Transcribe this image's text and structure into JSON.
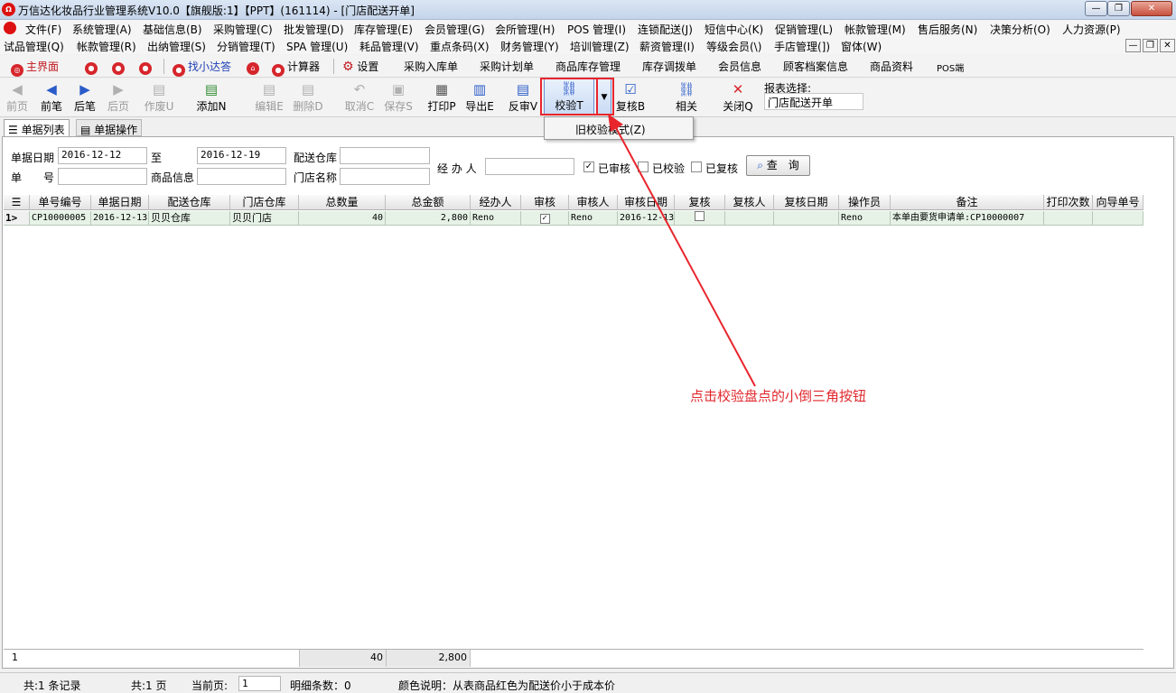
{
  "window": {
    "title": "万信达化妆品行业管理系统V10.0【旗舰版:1】【PPT】(161114) - [门店配送开单]",
    "logo": "Ω",
    "minimize": "—",
    "restore": "❐",
    "close": "✕"
  },
  "menu1": [
    "文件(F)",
    "系统管理(A)",
    "基础信息(B)",
    "采购管理(C)",
    "批发管理(D)",
    "库存管理(E)",
    "会员管理(G)",
    "会所管理(H)",
    "POS 管理(I)",
    "连锁配送(J)",
    "短信中心(K)",
    "促销管理(L)",
    "帐款管理(M)",
    "售后服务(N)",
    "决策分析(O)",
    "人力资源(P)"
  ],
  "menu2": [
    "试品管理(Q)",
    "帐款管理(R)",
    "出纳管理(S)",
    "分销管理(T)",
    "SPA 管理(U)",
    "耗品管理(V)",
    "重点条码(X)",
    "财务管理(Y)",
    "培训管理(Z)",
    "薪资管理(I)",
    "等级会员(\\)",
    "手店管理(])",
    "窗体(W)"
  ],
  "quickbar": {
    "main": "主界面",
    "find": "找小达答",
    "calc": "计算器",
    "settings": "设置",
    "items": [
      "采购入库单",
      "采购计划单",
      "商品库存管理",
      "库存调拨单",
      "会员信息",
      "顾客档案信息",
      "商品资料",
      "POS端"
    ]
  },
  "toolbar": {
    "first": "前页",
    "prev": "前笔",
    "next": "后笔",
    "last": "后页",
    "void": "作废U",
    "add": "添加N",
    "edit": "编辑E",
    "delete": "删除D",
    "cancel": "取消C",
    "save": "保存S",
    "print": "打印P",
    "export": "导出E",
    "unaudit": "反审V",
    "verify": "校验T",
    "recheck": "复核B",
    "related": "相关",
    "close": "关闭Q"
  },
  "report": {
    "label": "报表选择:",
    "value": "门店配送开单"
  },
  "dropdown": {
    "item": "旧校验模式(Z)"
  },
  "tabs": {
    "list": "单据列表",
    "ops": "单据操作"
  },
  "filters": {
    "date_label": "单据日期",
    "date_from": "2016-12-12",
    "to": "至",
    "date_to": "2016-12-19",
    "warehouse_label": "配送仓库",
    "handler_label": "经 办 人",
    "no_label": "单　　号",
    "goods_label": "商品信息",
    "store_label": "门店名称",
    "audited": "已审核",
    "verified": "已校验",
    "rechecked": "已复核",
    "query": "查　询"
  },
  "grid": {
    "headers": [
      "单号编号",
      "单据日期",
      "配送仓库",
      "门店仓库",
      "总数量",
      "总金额",
      "经办人",
      "审核",
      "审核人",
      "审核日期",
      "复核",
      "复核人",
      "复核日期",
      "操作员",
      "备注",
      "打印次数",
      "向导单号"
    ],
    "rows": [
      {
        "marker": "1>",
        "no": "CP10000005",
        "date": "2016-12-13",
        "warehouse": "贝贝仓库",
        "store": "贝贝门店",
        "qty": "40",
        "amount": "2,800",
        "handler": "Reno",
        "audited": "✓",
        "auditor": "Reno",
        "audit_date": "2016-12-13",
        "rechecked": "",
        "rechecker": "",
        "recheck_date": "",
        "operator": "Reno",
        "remark": "本单由要货申请单:CP10000007",
        "prints": "",
        "guide": ""
      }
    ]
  },
  "totals": {
    "count": "1",
    "qty": "40",
    "amount": "2,800"
  },
  "status": {
    "records": "共:1 条记录",
    "pages": "共:1 页",
    "current_label": "当前页:",
    "current": "1",
    "detail": "明细条数：0",
    "legend": "颜色说明：从表商品红色为配送价小于成本价"
  },
  "annotation": {
    "text": "点击校验盘点的小倒三角按钮",
    "color": "#e0282e"
  },
  "colors": {
    "accent": "#e8252d",
    "row_bg": "#e6f2e6"
  }
}
